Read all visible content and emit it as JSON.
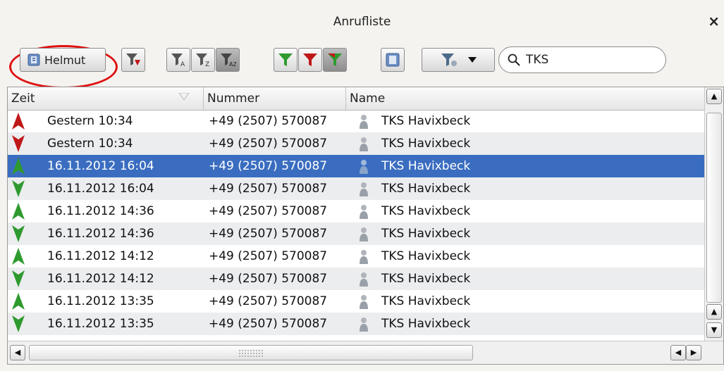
{
  "window": {
    "title": "Anrufliste",
    "close_label": "×"
  },
  "toolbar": {
    "user_button_label": "Helmut",
    "search_value": "TKS",
    "colors": {
      "incoming": "#2e9a2e",
      "outgoing": "#c01818",
      "highlight_oval": "#e01010"
    }
  },
  "table": {
    "columns": [
      "Zeit",
      "Nummer",
      "Name"
    ],
    "rows": [
      {
        "time": "Gestern 10:34",
        "number": "+49 (2507) 570087",
        "name": "TKS Havixbeck",
        "direction": "outgoing-up"
      },
      {
        "time": "Gestern 10:34",
        "number": "+49 (2507) 570087",
        "name": "TKS Havixbeck",
        "direction": "outgoing-down"
      },
      {
        "time": "16.11.2012 16:04",
        "number": "+49 (2507) 570087",
        "name": "TKS Havixbeck",
        "direction": "incoming-up"
      },
      {
        "time": "16.11.2012 16:04",
        "number": "+49 (2507) 570087",
        "name": "TKS Havixbeck",
        "direction": "incoming-down"
      },
      {
        "time": "16.11.2012 14:36",
        "number": "+49 (2507) 570087",
        "name": "TKS Havixbeck",
        "direction": "incoming-up"
      },
      {
        "time": "16.11.2012 14:36",
        "number": "+49 (2507) 570087",
        "name": "TKS Havixbeck",
        "direction": "incoming-down"
      },
      {
        "time": "16.11.2012 14:12",
        "number": "+49 (2507) 570087",
        "name": "TKS Havixbeck",
        "direction": "incoming-up"
      },
      {
        "time": "16.11.2012 14:12",
        "number": "+49 (2507) 570087",
        "name": "TKS Havixbeck",
        "direction": "incoming-down"
      },
      {
        "time": "16.11.2012 13:35",
        "number": "+49 (2507) 570087",
        "name": "TKS Havixbeck",
        "direction": "incoming-up"
      },
      {
        "time": "16.11.2012 13:35",
        "number": "+49 (2507) 570087",
        "name": "TKS Havixbeck",
        "direction": "incoming-down"
      }
    ],
    "selected_row": 2
  }
}
